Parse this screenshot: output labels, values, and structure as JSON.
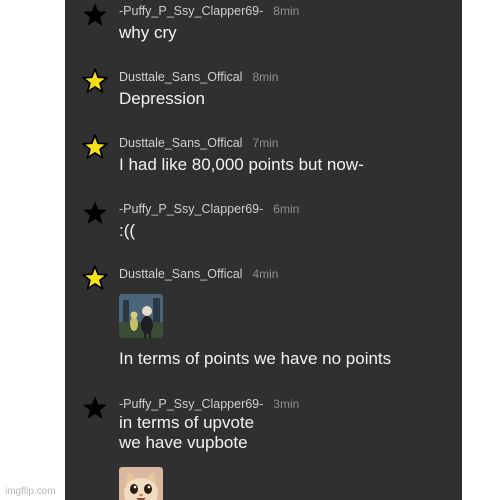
{
  "colors": {
    "panel_bg": "#303030",
    "username": "#cfcfcf",
    "timestamp": "#8f8f8f",
    "message_text": "#f2f2f2",
    "star_black": "#000000",
    "star_yellow": "#f5e11a"
  },
  "messages": [
    {
      "star": "black",
      "user": "-Puffy_P_Ssy_Clapper69-",
      "time": "8min",
      "text": "why cry"
    },
    {
      "star": "yellow",
      "user": "Dusttale_Sans_Offical",
      "time": "8min",
      "text": "Depression"
    },
    {
      "star": "yellow",
      "user": "Dusttale_Sans_Offical",
      "time": "7min",
      "text": "I had like 80,000 points but now-"
    },
    {
      "star": "black",
      "user": "-Puffy_P_Ssy_Clapper69-",
      "time": "6min",
      "text": ":(("
    },
    {
      "star": "yellow",
      "user": "Dusttale_Sans_Offical",
      "time": "4min",
      "image": "gru-meme-image",
      "text": "In terms of points we have no points"
    },
    {
      "star": "black",
      "user": "-Puffy_P_Ssy_Clapper69-",
      "time": "3min",
      "image": "cat-meme-image",
      "text": "in terms of upvote\nwe have vupbote"
    }
  ],
  "watermark": "imgflip.com"
}
